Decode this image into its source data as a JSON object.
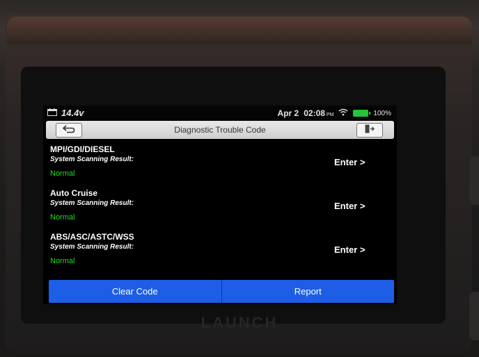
{
  "device": {
    "brand": "LAUNCH"
  },
  "statusbar": {
    "voltage": "14.4v",
    "date": "Apr 2",
    "time": "02:08",
    "ampm": "PM",
    "battery": "100%",
    "battery_color": "#26c23c"
  },
  "header": {
    "title": "Diagnostic Trouble Code"
  },
  "systems": [
    {
      "name": "MPI/GDI/DIESEL",
      "subtitle": "System Scanning Result:",
      "status": "Normal",
      "action": "Enter >"
    },
    {
      "name": "Auto Cruise",
      "subtitle": "System Scanning Result:",
      "status": "Normal",
      "action": "Enter >"
    },
    {
      "name": "ABS/ASC/ASTC/WSS",
      "subtitle": "System Scanning Result:",
      "status": "Normal",
      "action": "Enter >"
    }
  ],
  "footer": {
    "clear_label": "Clear Code",
    "report_label": "Report",
    "accent": "#1e5ee6"
  },
  "colors": {
    "status_ok": "#22dd22"
  }
}
